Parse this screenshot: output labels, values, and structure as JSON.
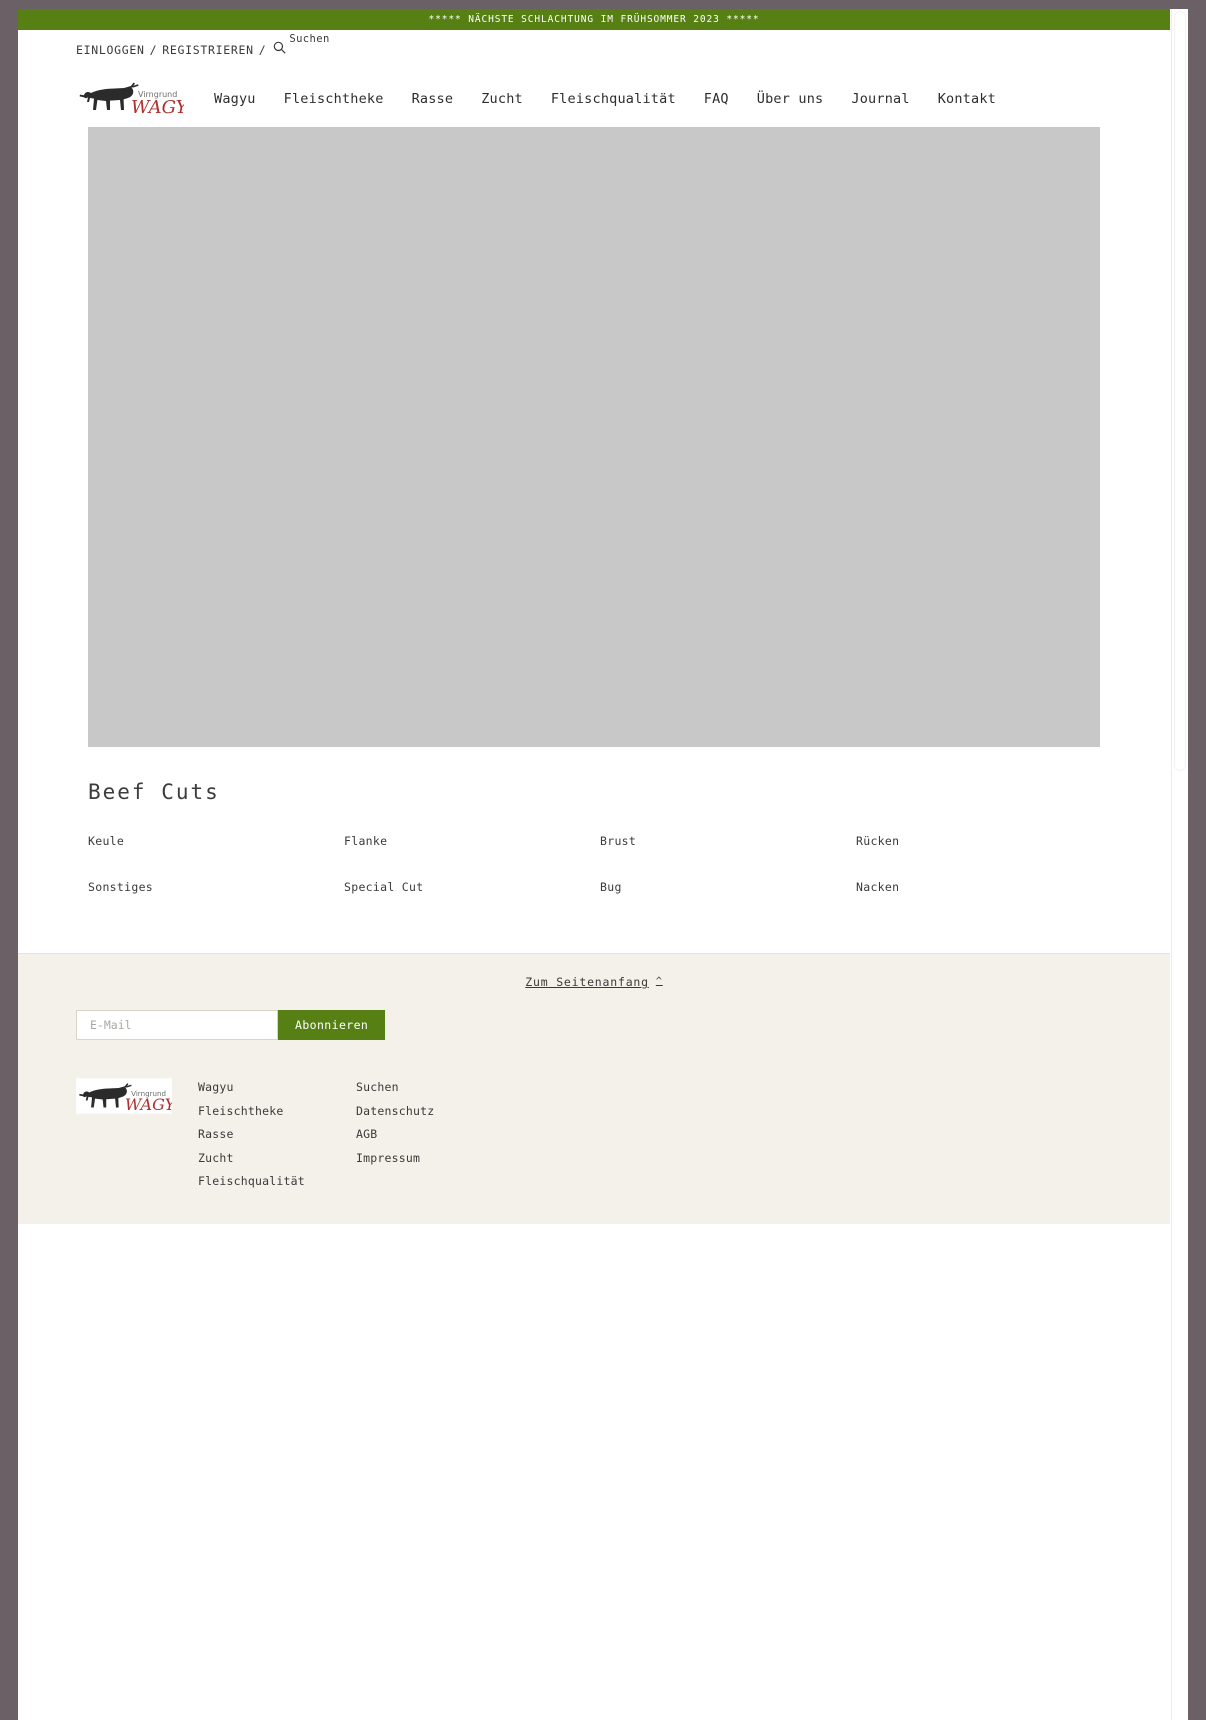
{
  "theme": {
    "brand_green": "#568013",
    "chrome_gray": "#6b6065",
    "hero_placeholder": "#c8c8c8",
    "card_placeholder": "#f1f1f1",
    "footer_bg": "#f4f1ea",
    "text_color": "#3a3a3a",
    "logo_word_red": "#b03030",
    "logo_word_gray": "#6e6e6e"
  },
  "announcement": {
    "text": "***** NÄCHSTE SCHLACHTUNG IM FRÜHSOMMER 2023 *****"
  },
  "utility": {
    "login_label": "EINLOGGEN",
    "separator_1": "/",
    "register_label": "REGISTRIEREN",
    "separator_2": "/",
    "search_icon": "search-icon",
    "search_label": "Suchen"
  },
  "brand": {
    "logo_icon": "bull-logo-icon",
    "word_top": "Virngrund",
    "word_main": "WAGYU"
  },
  "nav": {
    "items": [
      {
        "label": "Wagyu"
      },
      {
        "label": "Fleischtheke"
      },
      {
        "label": "Rasse"
      },
      {
        "label": "Zucht"
      },
      {
        "label": "Fleischqualität"
      },
      {
        "label": "FAQ"
      },
      {
        "label": "Über uns"
      },
      {
        "label": "Journal"
      },
      {
        "label": "Kontakt"
      }
    ]
  },
  "hero": {
    "image_placeholder": "hero-banner-image"
  },
  "beef_cuts": {
    "title": "Beef Cuts",
    "cards": [
      {
        "label": "Keule"
      },
      {
        "label": "Flanke"
      },
      {
        "label": "Brust"
      },
      {
        "label": "Rücken"
      },
      {
        "label": "Sonstiges"
      },
      {
        "label": "Special Cut"
      },
      {
        "label": "Bug"
      },
      {
        "label": "Nacken"
      }
    ]
  },
  "footer": {
    "to_top_label": "Zum Seitenanfang",
    "to_top_icon": "chevron-up-icon",
    "newsletter": {
      "email_placeholder": "E-Mail",
      "email_value": "",
      "submit_label": "Abonnieren"
    },
    "logo_icon": "bull-logo-icon",
    "columns": [
      {
        "links": [
          {
            "label": "Wagyu"
          },
          {
            "label": "Fleischtheke"
          },
          {
            "label": "Rasse"
          },
          {
            "label": "Zucht"
          },
          {
            "label": "Fleischqualität"
          }
        ]
      },
      {
        "links": [
          {
            "label": "Suchen"
          },
          {
            "label": "Datenschutz"
          },
          {
            "label": "AGB"
          },
          {
            "label": "Impressum"
          }
        ]
      }
    ]
  }
}
